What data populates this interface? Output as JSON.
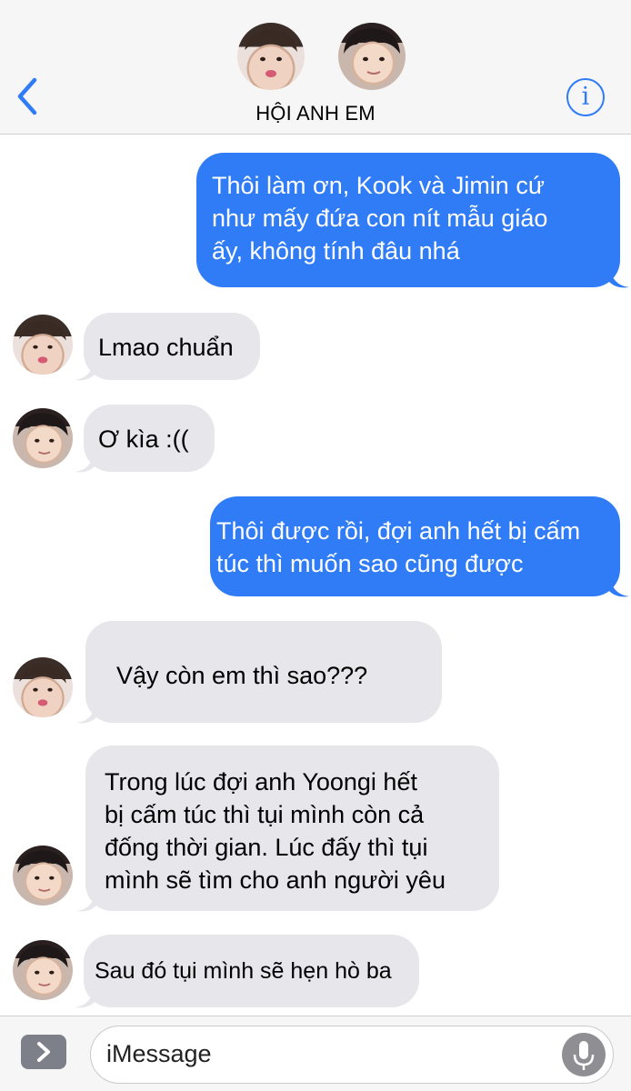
{
  "header": {
    "title": "HỘI ANH EM",
    "back_icon": "chevron-left-icon",
    "info_glyph": "i",
    "info_icon": "info-icon",
    "accent_color": "#2f7cf6"
  },
  "messages": [
    {
      "direction": "out",
      "text": "Thôi làm ơn, Kook và Jimin cứ\nnhư mấy đứa con nít mẫu giáo\nấy, không tính đâu nhá"
    },
    {
      "direction": "in",
      "sender": "v",
      "text": "Lmao chuẩn"
    },
    {
      "direction": "in",
      "sender": "jk",
      "text": "Ơ kìa :(("
    },
    {
      "direction": "out",
      "text": "Thôi được rồi, đợi anh hết bị cấm\ntúc thì muốn sao cũng được"
    },
    {
      "direction": "in",
      "sender": "v",
      "text": "Vậy còn em thì sao???"
    },
    {
      "direction": "in",
      "sender": "jk",
      "text": "Trong lúc đợi anh Yoongi hết\nbị cấm túc thì tụi mình còn cả\nđống thời gian. Lúc đấy thì tụi\nmình sẽ tìm cho anh người yêu"
    },
    {
      "direction": "in",
      "sender": "jk",
      "text": "Sau đó tụi mình sẽ hẹn hò ba"
    }
  ],
  "composer": {
    "placeholder": "iMessage",
    "app_icon": "app-store-chevron-icon",
    "mic_icon": "microphone-icon"
  },
  "colors": {
    "outgoing_bubble": "#2f7cf6",
    "incoming_bubble": "#e6e6eb",
    "header_bg": "#f6f6f6"
  }
}
